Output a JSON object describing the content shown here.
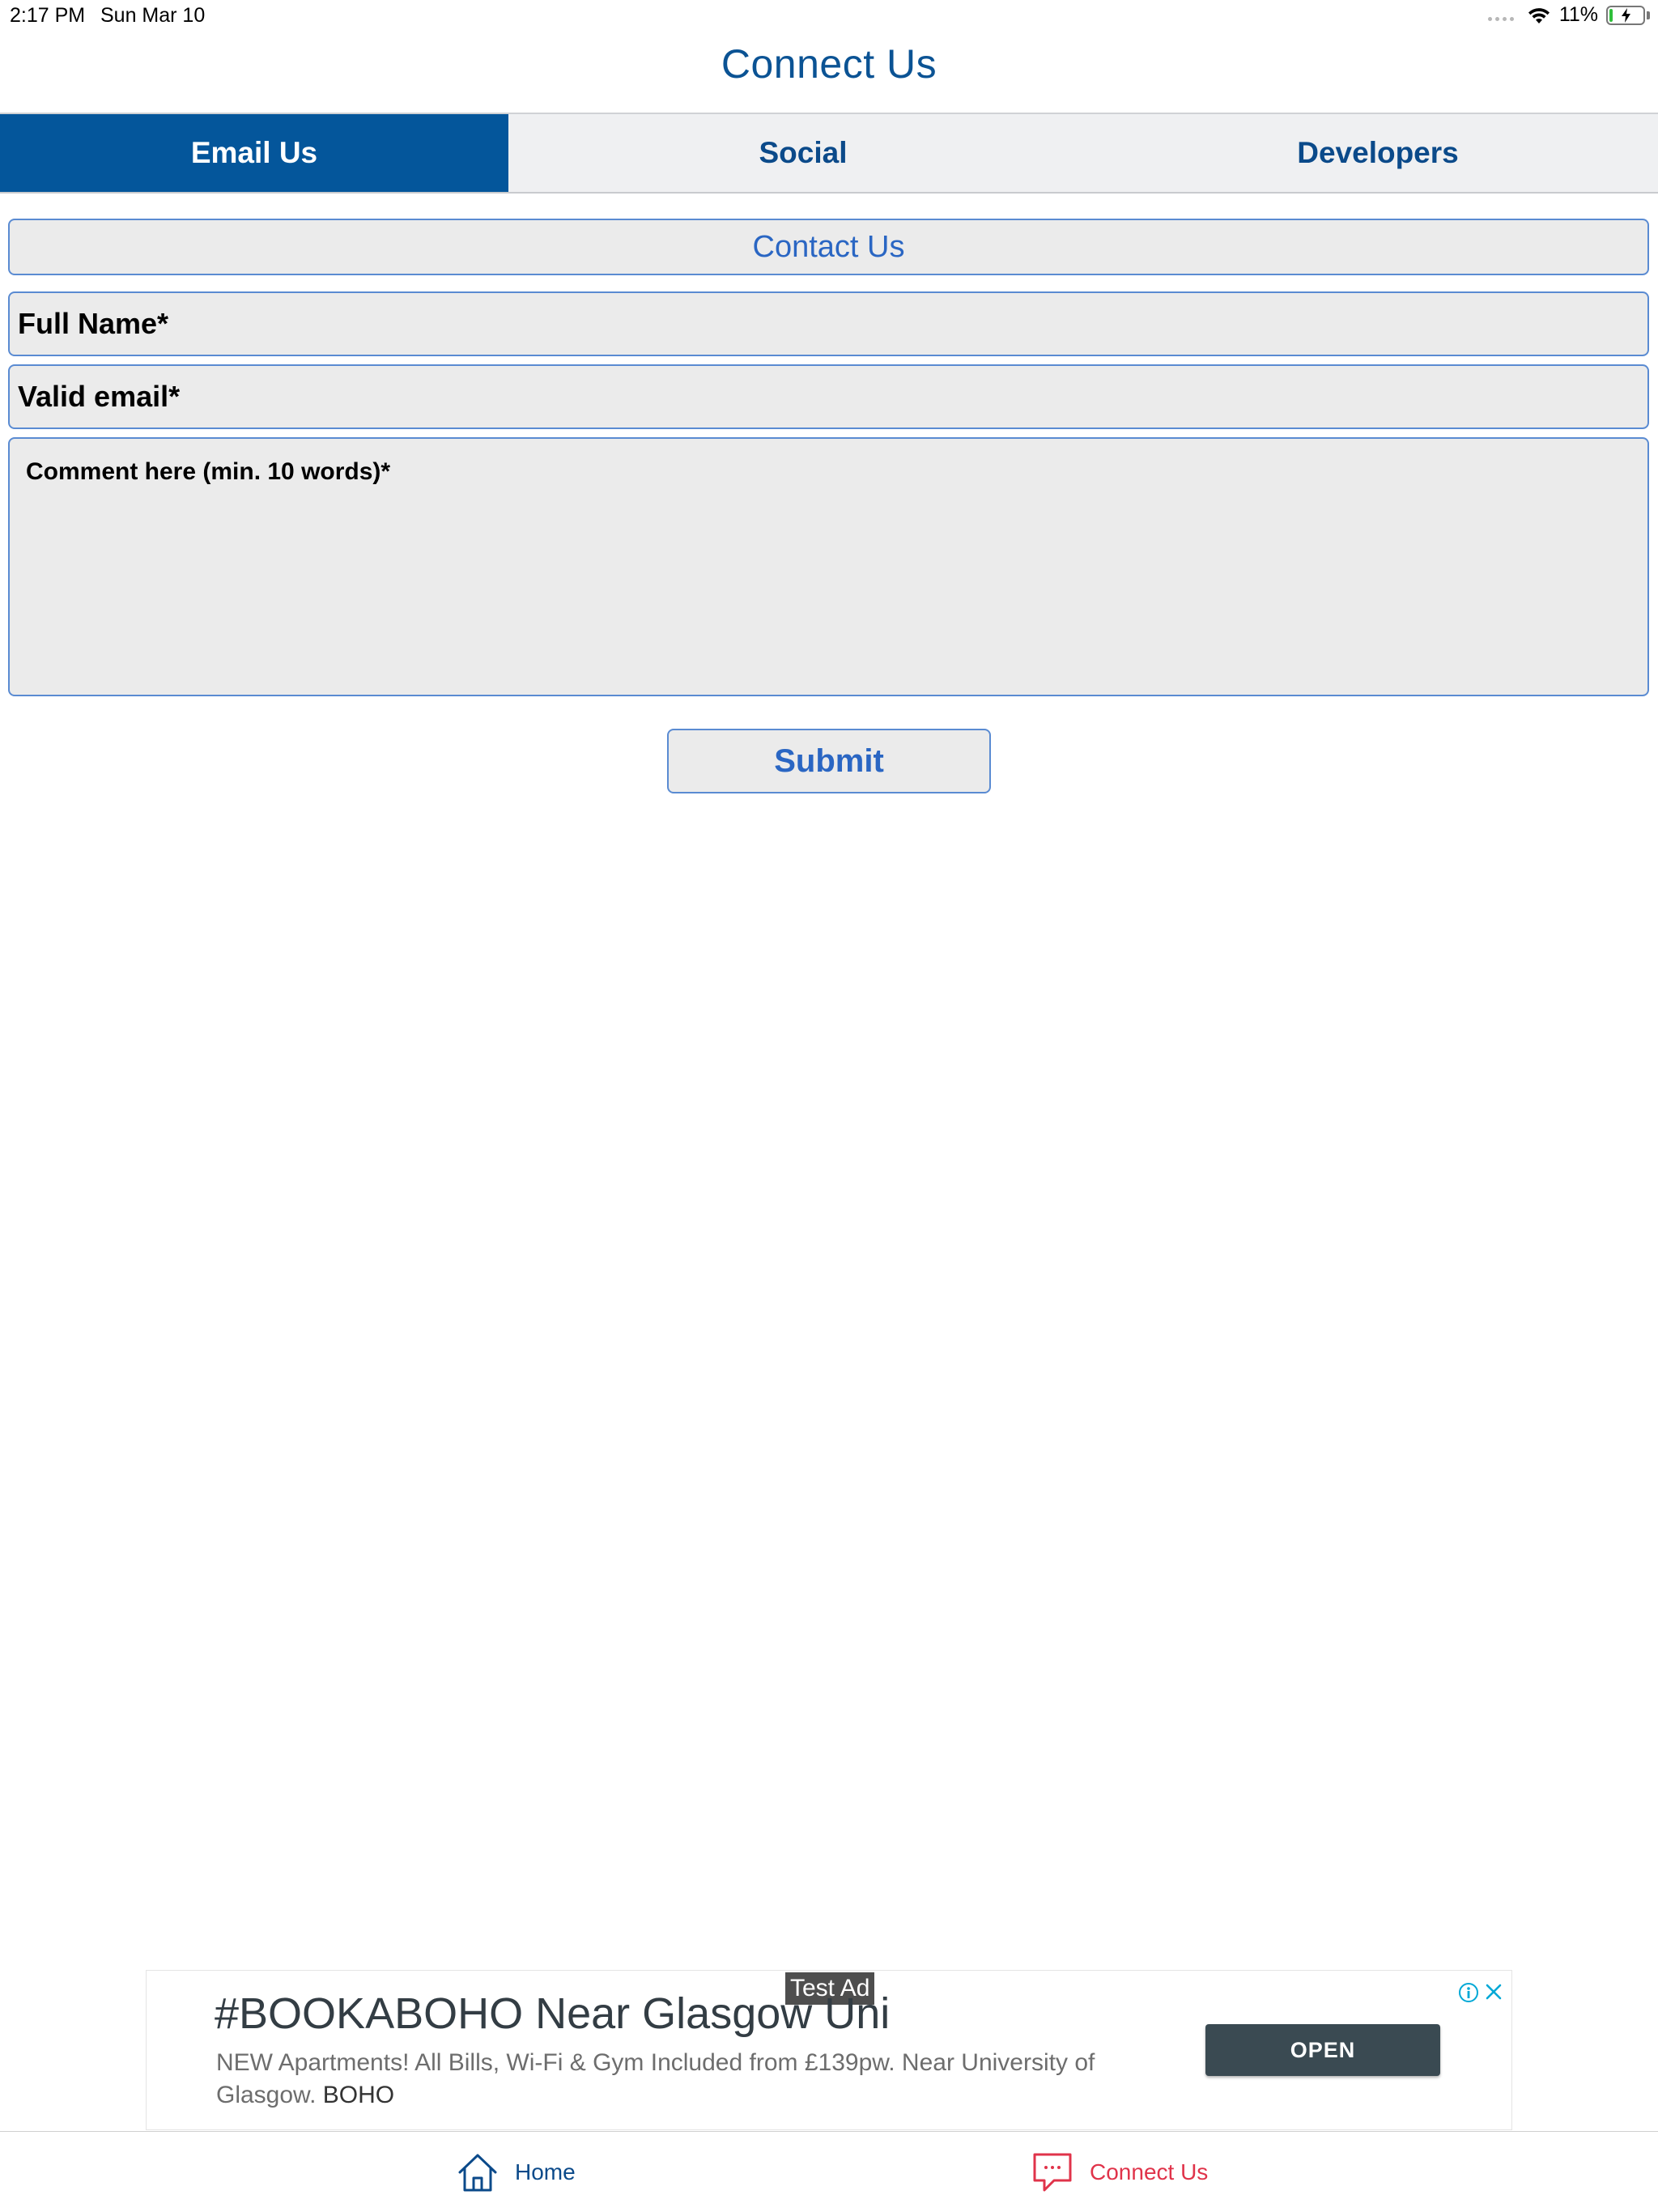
{
  "status_bar": {
    "time": "2:17 PM",
    "date": "Sun Mar 10",
    "battery": "11%",
    "battery_level": 0.11
  },
  "header": {
    "title": "Connect Us"
  },
  "tabs": [
    {
      "label": "Email Us",
      "active": true
    },
    {
      "label": "Social",
      "active": false
    },
    {
      "label": "Developers",
      "active": false
    }
  ],
  "form": {
    "heading": "Contact Us",
    "name_placeholder": "Full Name*",
    "email_placeholder": "Valid email*",
    "comment_placeholder": "Comment here (min. 10 words)*",
    "submit_label": "Submit"
  },
  "ad": {
    "test_label": "Test Ad",
    "headline": "#BOOKABOHO Near Glasgow Uni",
    "body": "NEW Apartments! All Bills, Wi-Fi & Gym Included from £139pw. Near University of Glasgow.",
    "brand": "BOHO",
    "cta_label": "OPEN",
    "icons": [
      "info-icon",
      "close-icon"
    ]
  },
  "bottom_nav": [
    {
      "label": "Home",
      "icon": "home-icon",
      "color": "#0b4a8a"
    },
    {
      "label": "Connect Us",
      "icon": "chat-bubble-icon",
      "color": "#e0334a",
      "active": true
    }
  ],
  "colors": {
    "primary": "#04569b",
    "title_blue": "#0b5394",
    "link_blue": "#2a66c3",
    "accent_red": "#e0334a"
  }
}
